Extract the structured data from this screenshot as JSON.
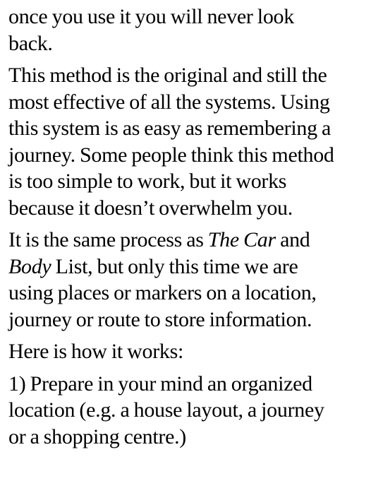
{
  "paragraphs": [
    {
      "lines": [
        "once you use it you will never look",
        "back."
      ]
    },
    {
      "lines": [
        "This method is the original and still the",
        "most effective of all the systems. Using",
        "this system is as easy as remembering a",
        "journey. Some people think this method",
        "is too simple to work, but it works",
        "because it doesn’t overwhelm you."
      ]
    },
    {
      "line1_a": "It is the same process as ",
      "line1_italic": "The Car",
      "line1_b": " and",
      "line2_italic": "Body",
      "line2_b": " List, but only this time we are",
      "lines": [
        "using places or markers on a location,",
        "journey or route to store information."
      ]
    },
    {
      "lines": [
        "Here is how it works:"
      ]
    },
    {
      "lines": [
        "1) Prepare in your mind an organized",
        "location (e.g. a house layout, a journey",
        "or a shopping centre.)"
      ]
    }
  ]
}
